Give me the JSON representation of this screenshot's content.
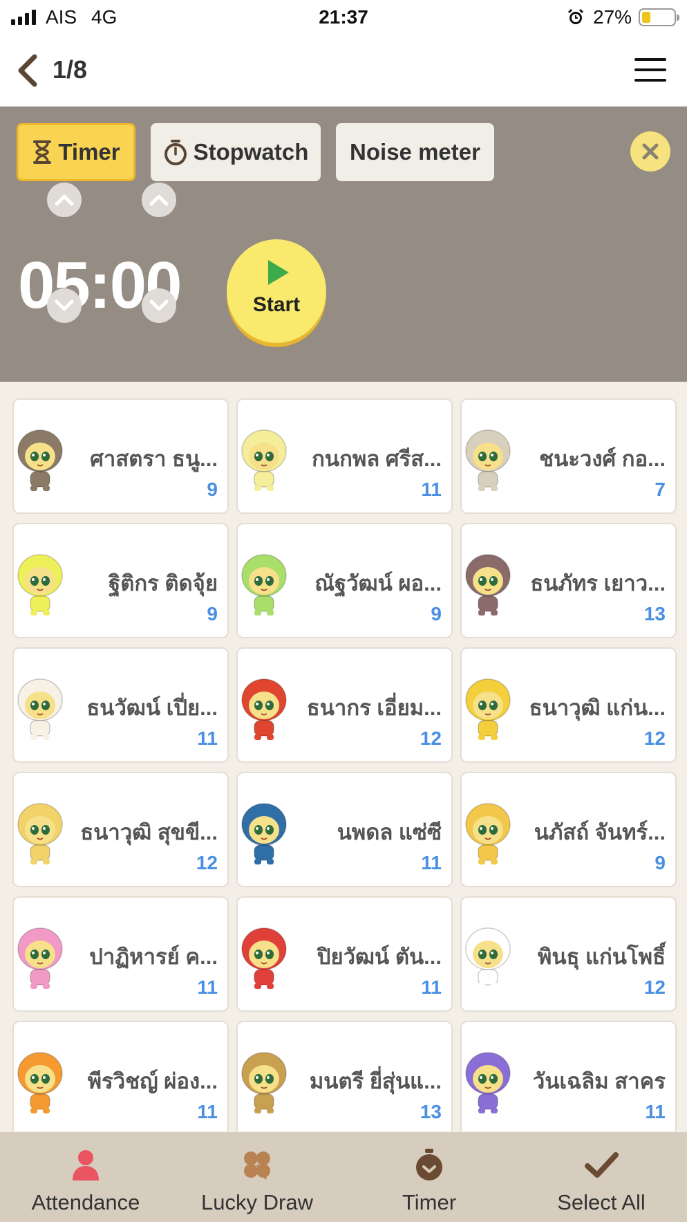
{
  "status_bar": {
    "carrier": "AIS",
    "network": "4G",
    "time": "21:37",
    "battery_percent": "27%"
  },
  "nav": {
    "page_counter": "1/8"
  },
  "tools": {
    "tabs": [
      {
        "label": "Timer",
        "icon": "hourglass-icon",
        "active": true
      },
      {
        "label": "Stopwatch",
        "icon": "stopwatch-icon",
        "active": false
      },
      {
        "label": "Noise meter",
        "active": false
      }
    ],
    "timer_value": "05:00",
    "start_label": "Start"
  },
  "students": [
    {
      "name": "ศาสตรา ธนู...",
      "points": "9",
      "avatar": "koala-avatar",
      "color": "#8a7a66"
    },
    {
      "name": "กนกพล ศรีส...",
      "points": "11",
      "avatar": "bird-avatar",
      "color": "#f4ee9a"
    },
    {
      "name": "ชนะวงศ์ กอ...",
      "points": "7",
      "avatar": "dog-avatar",
      "color": "#d9cfbd"
    },
    {
      "name": "ฐิติกร ติดจุ้ย",
      "points": "9",
      "avatar": "chick-avatar",
      "color": "#eef05a"
    },
    {
      "name": "ณัฐวัฒน์ ผอ...",
      "points": "9",
      "avatar": "leaf-avatar",
      "color": "#a9de6a"
    },
    {
      "name": "ธนภัทร เยาว...",
      "points": "13",
      "avatar": "hedgehog-avatar",
      "color": "#8b6a6a"
    },
    {
      "name": "ธนวัฒน์ เปี่ย...",
      "points": "11",
      "avatar": "egg-avatar",
      "color": "#f7f1e6"
    },
    {
      "name": "ธนากร เอี่ยม...",
      "points": "12",
      "avatar": "parrot-avatar",
      "color": "#e0462f"
    },
    {
      "name": "ธนาวุฒิ แก่น...",
      "points": "12",
      "avatar": "pineapple-avatar",
      "color": "#f2cf3b"
    },
    {
      "name": "ธนาวุฒิ สุขขี...",
      "points": "12",
      "avatar": "giraffe-avatar",
      "color": "#f1d36a"
    },
    {
      "name": "นพดล แซ่ซี",
      "points": "11",
      "avatar": "whale-avatar",
      "color": "#2f6ea6"
    },
    {
      "name": "นภัสถ์ จันทร์...",
      "points": "9",
      "avatar": "puppy-avatar",
      "color": "#f3c84a"
    },
    {
      "name": "ปาฏิหารย์ ค...",
      "points": "11",
      "avatar": "pig-avatar",
      "color": "#f29ac6"
    },
    {
      "name": "ปิยวัฒน์ ตัน...",
      "points": "11",
      "avatar": "strawberry-avatar",
      "color": "#e0403a"
    },
    {
      "name": "พินธุ แก่นโพธิ์",
      "points": "12",
      "avatar": "panda-avatar",
      "color": "#ffffff"
    },
    {
      "name": "พีรวิชญ์ ผ่อง...",
      "points": "11",
      "avatar": "orange-avatar",
      "color": "#f49a30"
    },
    {
      "name": "มนตรี ยี่สุ่นแ...",
      "points": "13",
      "avatar": "raccoon-avatar",
      "color": "#c9a050"
    },
    {
      "name": "วันเฉลิม สาคร",
      "points": "11",
      "avatar": "dragon-avatar",
      "color": "#8a6ed6"
    }
  ],
  "bottom_bar": [
    {
      "label": "Attendance",
      "icon": "person-icon",
      "color": "#ea5561"
    },
    {
      "label": "Lucky Draw",
      "icon": "clover-icon",
      "color": "#b88252"
    },
    {
      "label": "Timer",
      "icon": "timer-icon",
      "color": "#6b4a33"
    },
    {
      "label": "Select All",
      "icon": "checkmark-icon",
      "color": "#6b4a33"
    }
  ]
}
